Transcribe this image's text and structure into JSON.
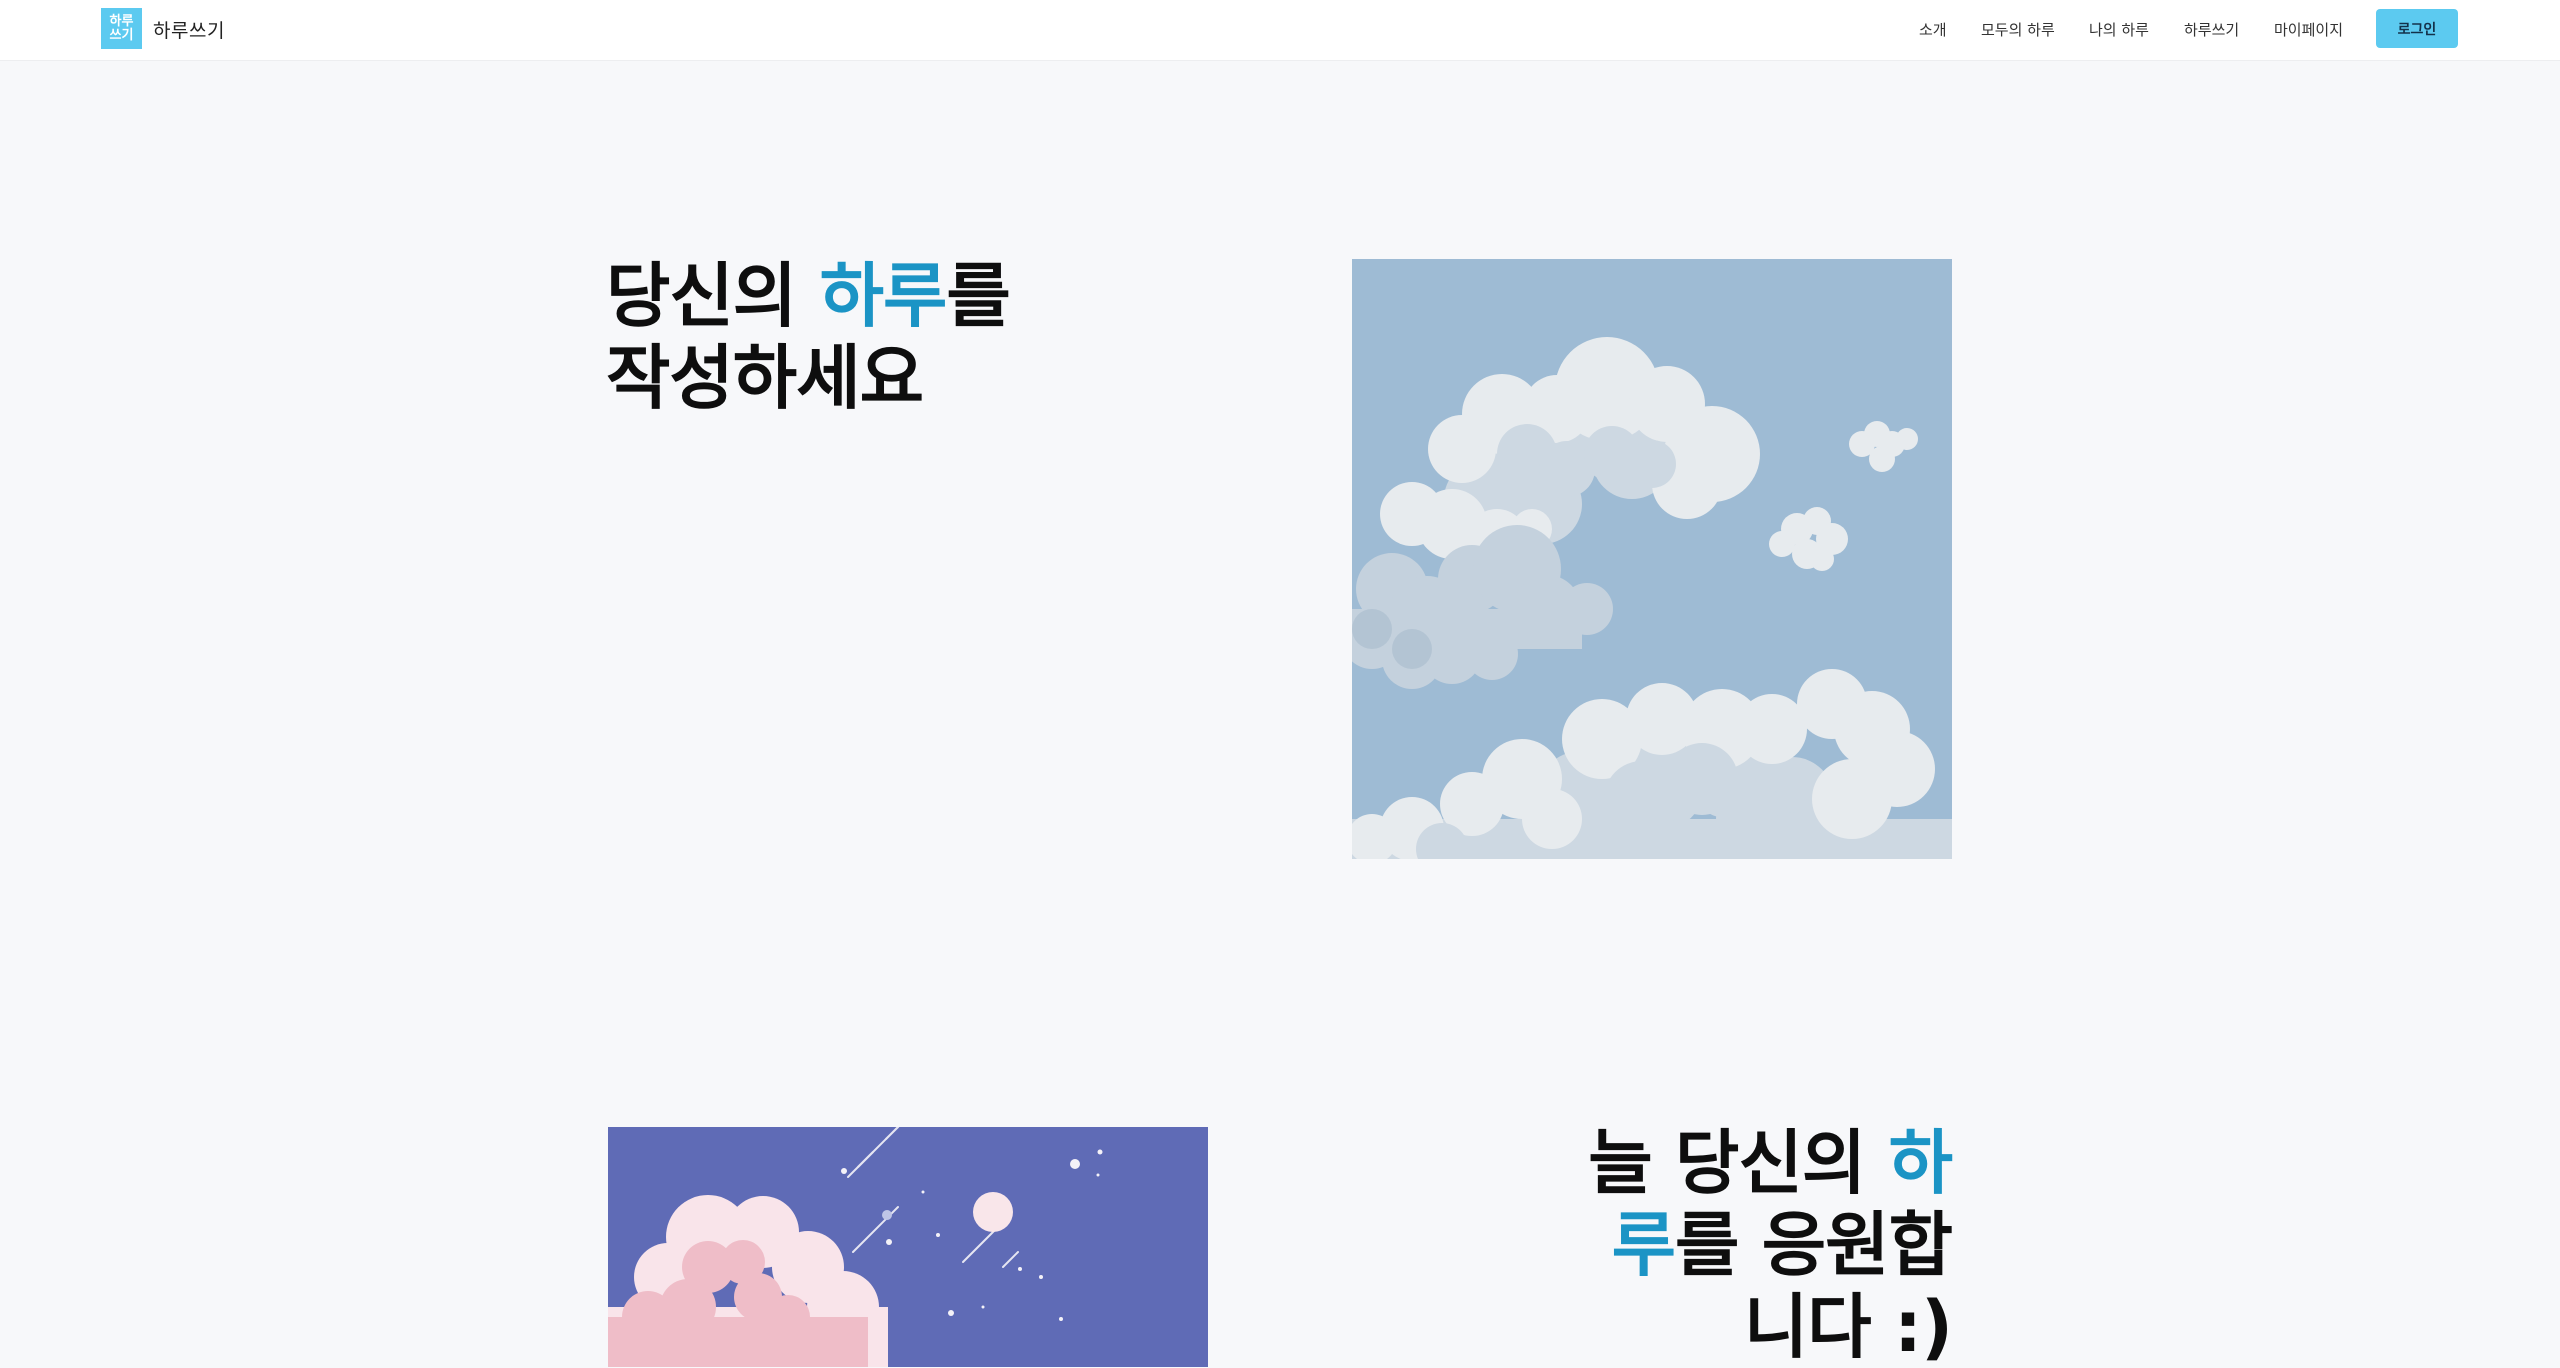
{
  "brand": {
    "logo_line1": "하루",
    "logo_line2": "쓰기",
    "name": "하루쓰기",
    "accent_color": "#5ccaf0"
  },
  "nav": {
    "items": [
      {
        "label": "소개"
      },
      {
        "label": "모두의 하루"
      },
      {
        "label": "나의 하루"
      },
      {
        "label": "하루쓰기"
      },
      {
        "label": "마이페이지"
      }
    ],
    "login_label": "로그인"
  },
  "hero": {
    "line1_pre": "당신의 ",
    "line1_accent": "하루",
    "line1_post": "를",
    "line2": "작성하세요"
  },
  "section2": {
    "line1_pre": "늘 당신의 ",
    "line1_accent": "하",
    "line2_accent": "루",
    "line2_post": "를 응원합",
    "line3": "니다 :)"
  },
  "colors": {
    "highlight": "#1b94c5",
    "sky_background": "#9ebbd4",
    "night_background": "#5f6bb6",
    "page_background": "#f7f8fa"
  },
  "illustrations": {
    "sky": "clouds-illustration",
    "night": "night-sky-illustration"
  }
}
